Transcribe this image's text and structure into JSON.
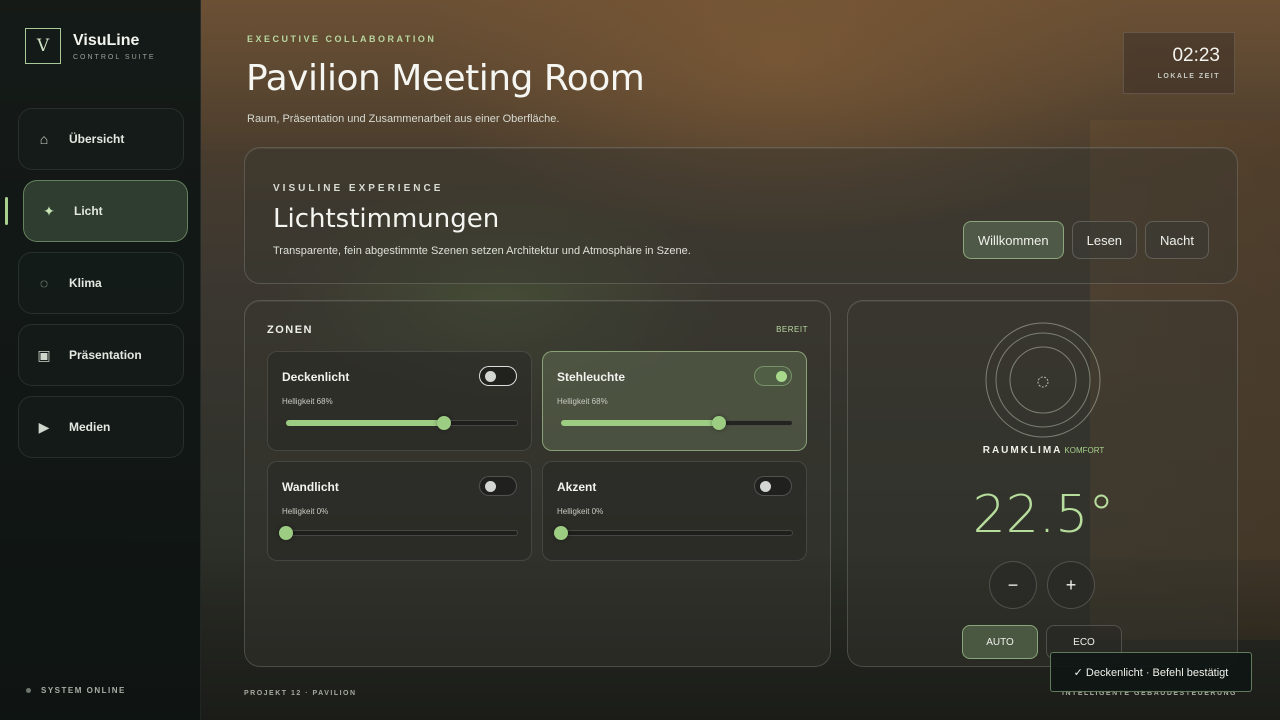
{
  "brand": {
    "logo_letter": "V",
    "name": "VisuLine",
    "subtitle": "CONTROL SUITE"
  },
  "nav": {
    "items": [
      {
        "label": "Übersicht",
        "icon": "home-icon",
        "glyph": "⌂",
        "active": false
      },
      {
        "label": "Licht",
        "icon": "sparkle-icon",
        "glyph": "✦",
        "active": true
      },
      {
        "label": "Klima",
        "icon": "circle-icon",
        "glyph": "◌",
        "active": false
      },
      {
        "label": "Präsentation",
        "icon": "screen-icon",
        "glyph": "▣",
        "active": false
      },
      {
        "label": "Medien",
        "icon": "play-icon",
        "glyph": "▶",
        "active": false
      }
    ]
  },
  "system_status": "SYSTEM ONLINE",
  "header": {
    "eyebrow": "EXECUTIVE COLLABORATION",
    "title": "Pavilion Meeting Room",
    "subtitle": "Raum, Präsentation und Zusammenarbeit aus einer Oberfläche."
  },
  "clock": {
    "time": "02:23",
    "label": "LOKALE ZEIT"
  },
  "scenes": {
    "eyebrow": "VISULINE EXPERIENCE",
    "title": "Lichtstimmungen",
    "description": "Transparente, fein abgestimmte Szenen setzen Architektur und Atmosphäre in Szene.",
    "buttons": [
      {
        "label": "Willkommen",
        "active": true
      },
      {
        "label": "Lesen",
        "active": false
      },
      {
        "label": "Nacht",
        "active": false
      }
    ]
  },
  "zones": {
    "title": "ZONEN",
    "status": "BEREIT",
    "items": [
      {
        "name": "Deckenlicht",
        "brightness_label": "Helligkeit 68%",
        "brightness": 68,
        "on": false,
        "focused": true
      },
      {
        "name": "Stehleuchte",
        "brightness_label": "Helligkeit 68%",
        "brightness": 68,
        "on": true,
        "focused": false
      },
      {
        "name": "Wandlicht",
        "brightness_label": "Helligkeit 0%",
        "brightness": 0,
        "on": false,
        "focused": false
      },
      {
        "name": "Akzent",
        "brightness_label": "Helligkeit 0%",
        "brightness": 0,
        "on": false,
        "focused": false
      }
    ]
  },
  "climate": {
    "label": "RAUMKLIMA",
    "mode": "KOMFORT",
    "temperature": "22.5°",
    "minus_label": "−",
    "plus_label": "+",
    "modes": [
      {
        "label": "AUTO",
        "active": true
      },
      {
        "label": "ECO",
        "active": false
      }
    ]
  },
  "footer": {
    "left": "PROJEKT 12 · PAVILION",
    "right": "INTELLIGENTE GEBÄUDESTEUERUNG"
  },
  "toast": "✓ Deckenlicht · Befehl bestätigt",
  "colors": {
    "accent": "#9dcd82",
    "accent_text": "#b6dd9c",
    "sidebar_bg": "#121816"
  }
}
